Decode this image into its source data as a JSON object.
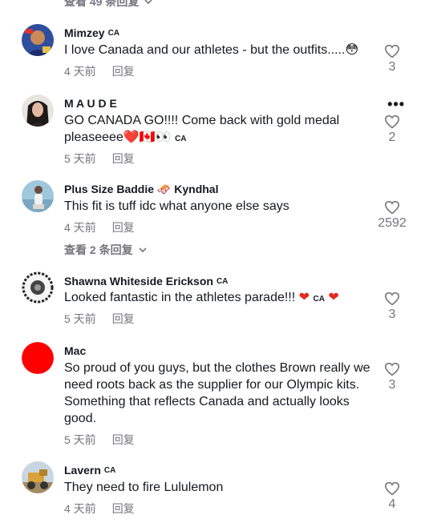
{
  "top_replies": {
    "label": "查看 49 条回复"
  },
  "comments": [
    {
      "username": "Mimzey",
      "region": "CA",
      "text": "I love Canada and our athletes - but the outfits.....😳",
      "time": "4 天前",
      "reply": "回复",
      "likes": "3"
    },
    {
      "username": "M A U D E",
      "region": "CA",
      "text_line1": "GO CANADA GO!!!! Come back with gold medal",
      "text_line2": "pleaseeee",
      "emoji": "❤️🇨🇦👀",
      "time": "5 天前",
      "reply": "回复",
      "likes": "2"
    },
    {
      "username": "Plus Size Baddie 🛷 Kyndhal",
      "text": "This fit is tuff idc what anyone else says",
      "time": "4 天前",
      "reply": "回复",
      "likes": "2592",
      "view_replies": "查看 2 条回复"
    },
    {
      "username": "Shawna Whiteside Erickson",
      "region": "CA",
      "text": "Looked fantastic in the athletes parade!!!",
      "time": "5 天前",
      "reply": "回复",
      "likes": "3"
    },
    {
      "username": "Mac",
      "text": "So proud of you guys, but the clothes Brown really we need roots back as the supplier for our Olympic kits. Something that reflects Canada and actually looks good.",
      "time": "5 天前",
      "reply": "回复",
      "likes": "3"
    },
    {
      "username": "Lavern",
      "region": "CA",
      "text": "They need to fire Lululemon",
      "time": "4 天前",
      "reply": "回复",
      "likes": "4"
    }
  ],
  "icons": {
    "like": "heart-outline-icon",
    "chevron": "chevron-down-icon",
    "more": "more-options-icon"
  },
  "colors": {
    "muted": "#75757d",
    "text": "#161823",
    "heart": "#e32b1d"
  }
}
